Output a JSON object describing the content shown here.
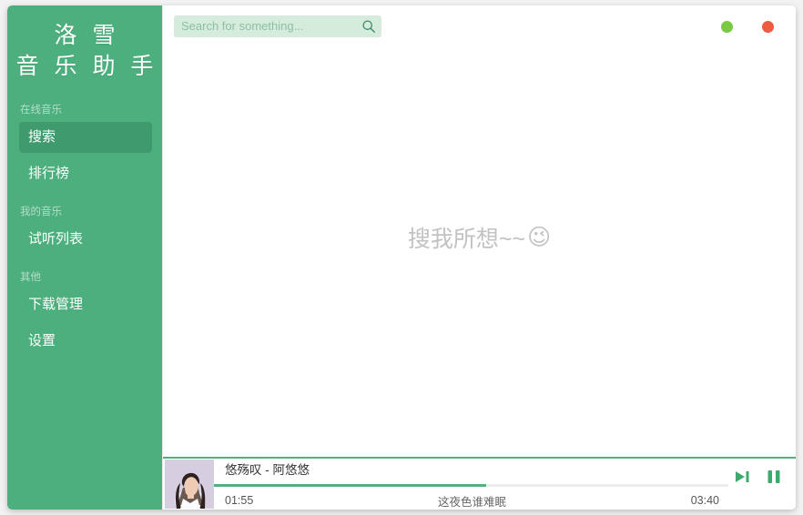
{
  "app": {
    "brand_line1": "洛 雪",
    "brand_line2": "音 乐 助 手"
  },
  "colors": {
    "sidebar_green": "#4caf7d",
    "sidebar_active_green": "#3f9b6d",
    "accent_green": "#52b07f",
    "search_bg": "#d5ecdc",
    "minimize_dot": "#7ac943",
    "close_dot": "#ef5b41",
    "hint_gray": "#c2c2c2"
  },
  "sidebar": {
    "sections": [
      {
        "label": "在线音乐",
        "items": [
          {
            "label": "搜索",
            "name": "sidebar-item-search",
            "active": true
          },
          {
            "label": "排行榜",
            "name": "sidebar-item-leaderboard",
            "active": false
          }
        ]
      },
      {
        "label": "我的音乐",
        "items": [
          {
            "label": "试听列表",
            "name": "sidebar-item-playlist",
            "active": false
          }
        ]
      },
      {
        "label": "其他",
        "items": [
          {
            "label": "下载管理",
            "name": "sidebar-item-downloads",
            "active": false
          },
          {
            "label": "设置",
            "name": "sidebar-item-settings",
            "active": false
          }
        ]
      }
    ]
  },
  "topbar": {
    "search": {
      "value": "",
      "placeholder": "Search for something...",
      "icon": "search-icon"
    },
    "window_controls": [
      {
        "name": "minimize-button",
        "icon": "minimize-dot-icon",
        "color": "#7ac943"
      },
      {
        "name": "close-button",
        "icon": "close-dot-icon",
        "color": "#ef5b41"
      }
    ]
  },
  "main": {
    "empty_hint_text": "搜我所想~~",
    "empty_hint_emoji": "😉"
  },
  "player": {
    "track_title": "悠殇叹 - 阿悠悠",
    "time_current": "01:55",
    "time_total": "03:40",
    "lyric_line": "这夜色谁难眠",
    "progress_percent": 53,
    "album_art_name": "album-art",
    "controls": [
      {
        "name": "next-track-button",
        "icon": "skip-forward-icon"
      },
      {
        "name": "pause-button",
        "icon": "pause-icon"
      }
    ]
  }
}
